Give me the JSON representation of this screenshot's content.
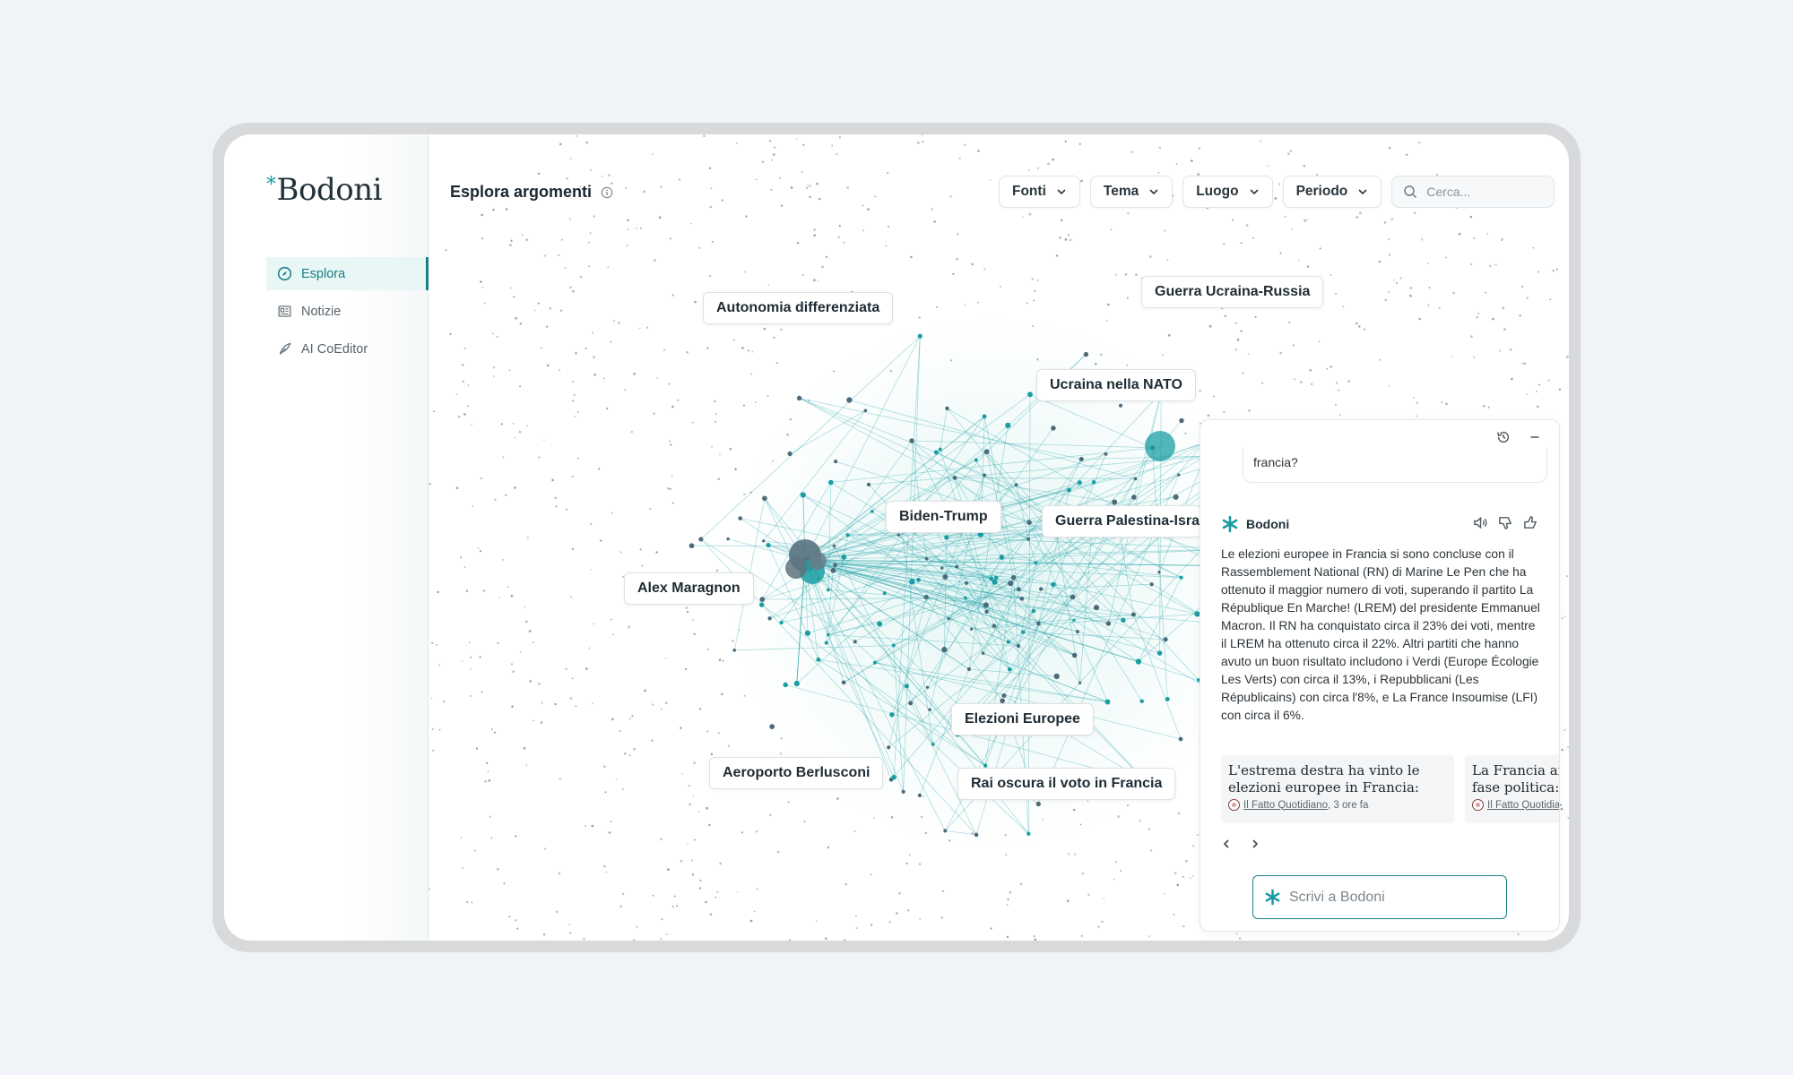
{
  "app": {
    "logo_text": "Bodoni",
    "logo_mark": "*"
  },
  "sidebar": {
    "items": [
      {
        "label": "Esplora",
        "icon": "compass-icon",
        "active": true
      },
      {
        "label": "Notizie",
        "icon": "newspaper-icon",
        "active": false
      },
      {
        "label": "AI CoEditor",
        "icon": "feather-icon",
        "active": false
      }
    ]
  },
  "header": {
    "title": "Esplora argomenti",
    "filters": [
      {
        "label": "Fonti"
      },
      {
        "label": "Tema"
      },
      {
        "label": "Luogo"
      },
      {
        "label": "Periodo"
      }
    ],
    "search_placeholder": "Cerca..."
  },
  "graph": {
    "topics": [
      "Autonomia differenziata",
      "Guerra Ucraina-Russia",
      "Ucraina nella NATO",
      "Biden-Trump",
      "Guerra Palestina-Israele",
      "Alex Maragnon",
      "Elezioni Europee",
      "Aeroporto Berlusconi",
      "Rai oscura il voto in Francia"
    ],
    "accent_color": "#1a9ea3"
  },
  "chat": {
    "user_message": "francia?",
    "bot_name": "Bodoni",
    "answer": "Le elezioni europee in Francia si sono concluse con il Rassemblement National (RN) di Marine Le Pen che ha ottenuto il maggior numero di voti, superando il partito La République En Marche! (LREM) del presidente Emmanuel Macron. Il RN ha conquistato circa il 23% dei voti, mentre il LREM ha ottenuto circa il 22%. Altri partiti che hanno avuto un buon risultato includono i Verdi (Europe Écologie Les Verts) con circa il 13%, i Repubblicani (Les Républicains) con circa l'8%, e La France Insoumise (LFI) con circa il 6%.",
    "sources": [
      {
        "title": "L'estrema destra ha vinto le elezioni europee in Francia: come ha votato l...",
        "source": "Il Fatto Quotidiano",
        "time": ", 3 ore fa"
      },
      {
        "title": "La Francia affronta una nuova fase politica: quattro scenari",
        "source": "Il Fatto Quotidiano",
        "time": ""
      }
    ],
    "input_placeholder": "Scrivi a Bodoni"
  }
}
